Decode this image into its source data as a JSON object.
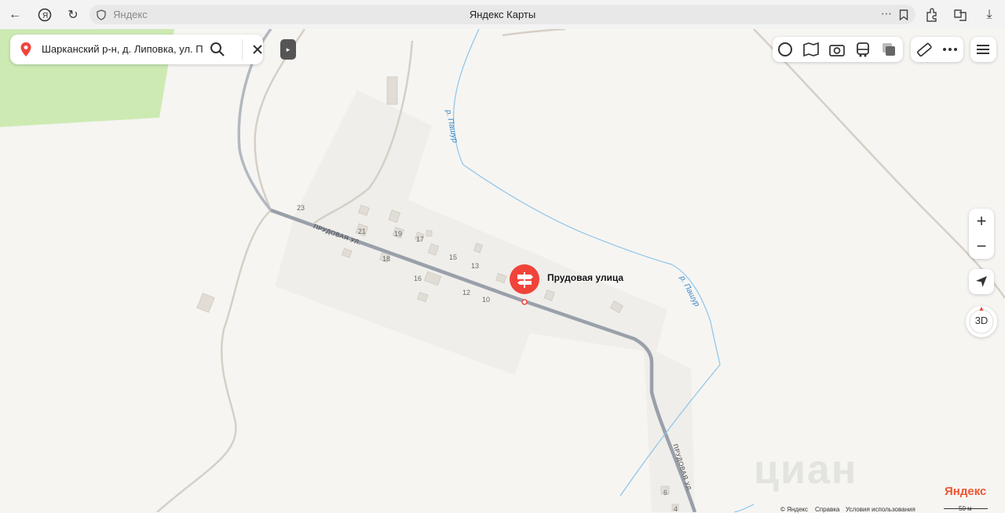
{
  "browser": {
    "host": "Яндекс",
    "title": "Яндекс Карты"
  },
  "search": {
    "query": "Шарканский р-н, д. Липовка, ул. Прудовая"
  },
  "map": {
    "pin_label": "Прудовая улица",
    "streets": [
      "ПРУДОВАЯ УЛ.",
      "ПРУДОВАЯ УЛ."
    ],
    "rivers": [
      "р. Пашур",
      "р. Пашур"
    ],
    "house_numbers": [
      "23",
      "21",
      "19",
      "17",
      "18",
      "15",
      "13",
      "16",
      "12",
      "10",
      "6",
      "4"
    ],
    "watermark": "циан",
    "colors": {
      "road": "#9aa0aa",
      "river": "#8cc4ea",
      "forest": "#cdeab3",
      "pin": "#f0443a"
    }
  },
  "controls": {
    "zoom_in": "+",
    "zoom_out": "−",
    "btn_3d": "3D"
  },
  "footer": {
    "logo": "Яндекс",
    "copyright": "© Яндекс",
    "help": "Справка",
    "terms": "Условия использования",
    "scale": "50 м"
  }
}
